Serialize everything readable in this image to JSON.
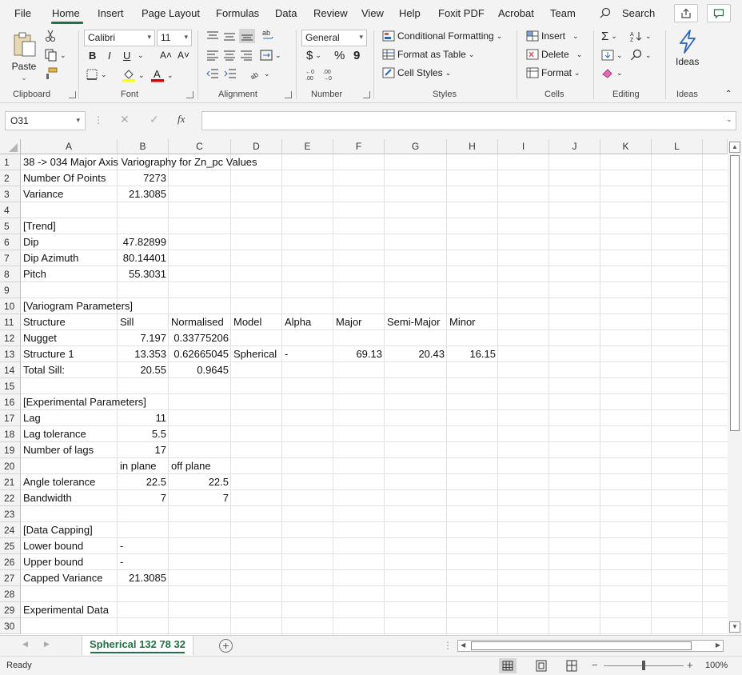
{
  "menu": {
    "items": [
      "File",
      "Home",
      "Insert",
      "Page Layout",
      "Formulas",
      "Data",
      "Review",
      "View",
      "Help",
      "Foxit PDF",
      "Acrobat",
      "Team"
    ],
    "search_label": "Search"
  },
  "ribbon": {
    "clipboard": {
      "label": "Clipboard",
      "paste": "Paste"
    },
    "font": {
      "label": "Font",
      "font_name": "Calibri",
      "font_size": "11",
      "bold": "B",
      "italic": "I",
      "underline": "U",
      "grow": "A˄",
      "shrink": "A˅"
    },
    "alignment": {
      "label": "Alignment"
    },
    "number": {
      "label": "Number",
      "format": "General",
      "currency": "$",
      "percent": "%",
      "comma": "9"
    },
    "styles": {
      "label": "Styles",
      "conditional": "Conditional Formatting",
      "format_table": "Format as Table",
      "cell_styles": "Cell Styles"
    },
    "cells": {
      "label": "Cells",
      "insert": "Insert",
      "delete": "Delete",
      "format": "Format"
    },
    "editing": {
      "label": "Editing"
    },
    "ideas": {
      "label": "Ideas",
      "button": "Ideas"
    }
  },
  "formula_bar": {
    "name_box": "O31",
    "fx": "fx",
    "formula": ""
  },
  "columns": [
    "A",
    "B",
    "C",
    "D",
    "E",
    "F",
    "G",
    "H",
    "I",
    "J",
    "K",
    "L"
  ],
  "rows": [
    "1",
    "2",
    "3",
    "4",
    "5",
    "6",
    "7",
    "8",
    "9",
    "10",
    "11",
    "12",
    "13",
    "14",
    "15",
    "16",
    "17",
    "18",
    "19",
    "20",
    "21",
    "22",
    "23",
    "24",
    "25",
    "26",
    "27",
    "28",
    "29",
    "30"
  ],
  "cells": [
    {
      "r": 1,
      "c": "A",
      "v": "38 -> 034 Major Axis Variography for Zn_pc Values"
    },
    {
      "r": 2,
      "c": "A",
      "v": "Number Of Points"
    },
    {
      "r": 2,
      "c": "B",
      "v": "7273",
      "align": "r"
    },
    {
      "r": 3,
      "c": "A",
      "v": "Variance"
    },
    {
      "r": 3,
      "c": "B",
      "v": "21.3085",
      "align": "r"
    },
    {
      "r": 5,
      "c": "A",
      "v": "[Trend]"
    },
    {
      "r": 6,
      "c": "A",
      "v": "Dip"
    },
    {
      "r": 6,
      "c": "B",
      "v": "47.82899",
      "align": "r"
    },
    {
      "r": 7,
      "c": "A",
      "v": "Dip Azimuth"
    },
    {
      "r": 7,
      "c": "B",
      "v": "80.14401",
      "align": "r"
    },
    {
      "r": 8,
      "c": "A",
      "v": "Pitch"
    },
    {
      "r": 8,
      "c": "B",
      "v": "55.3031",
      "align": "r"
    },
    {
      "r": 10,
      "c": "A",
      "v": "[Variogram Parameters]"
    },
    {
      "r": 11,
      "c": "A",
      "v": "Structure"
    },
    {
      "r": 11,
      "c": "B",
      "v": "Sill"
    },
    {
      "r": 11,
      "c": "C",
      "v": "Normalised"
    },
    {
      "r": 11,
      "c": "D",
      "v": "Model"
    },
    {
      "r": 11,
      "c": "E",
      "v": "Alpha"
    },
    {
      "r": 11,
      "c": "F",
      "v": "Major"
    },
    {
      "r": 11,
      "c": "G",
      "v": "Semi-Major"
    },
    {
      "r": 11,
      "c": "H",
      "v": "Minor"
    },
    {
      "r": 12,
      "c": "A",
      "v": "Nugget"
    },
    {
      "r": 12,
      "c": "B",
      "v": "7.197",
      "align": "r"
    },
    {
      "r": 12,
      "c": "C",
      "v": "0.33775206",
      "align": "r"
    },
    {
      "r": 13,
      "c": "A",
      "v": "Structure 1"
    },
    {
      "r": 13,
      "c": "B",
      "v": "13.353",
      "align": "r"
    },
    {
      "r": 13,
      "c": "C",
      "v": "0.62665045",
      "align": "r"
    },
    {
      "r": 13,
      "c": "D",
      "v": "Spherical"
    },
    {
      "r": 13,
      "c": "E",
      "v": "-"
    },
    {
      "r": 13,
      "c": "F",
      "v": "69.13",
      "align": "r"
    },
    {
      "r": 13,
      "c": "G",
      "v": "20.43",
      "align": "r"
    },
    {
      "r": 13,
      "c": "H",
      "v": "16.15",
      "align": "r"
    },
    {
      "r": 14,
      "c": "A",
      "v": "Total Sill:"
    },
    {
      "r": 14,
      "c": "B",
      "v": "20.55",
      "align": "r"
    },
    {
      "r": 14,
      "c": "C",
      "v": "0.9645",
      "align": "r"
    },
    {
      "r": 16,
      "c": "A",
      "v": "[Experimental Parameters]"
    },
    {
      "r": 17,
      "c": "A",
      "v": "Lag"
    },
    {
      "r": 17,
      "c": "B",
      "v": "11",
      "align": "r"
    },
    {
      "r": 18,
      "c": "A",
      "v": "Lag tolerance"
    },
    {
      "r": 18,
      "c": "B",
      "v": "5.5",
      "align": "r"
    },
    {
      "r": 19,
      "c": "A",
      "v": "Number of lags"
    },
    {
      "r": 19,
      "c": "B",
      "v": "17",
      "align": "r"
    },
    {
      "r": 20,
      "c": "B",
      "v": "in plane"
    },
    {
      "r": 20,
      "c": "C",
      "v": "off plane"
    },
    {
      "r": 21,
      "c": "A",
      "v": "Angle tolerance"
    },
    {
      "r": 21,
      "c": "B",
      "v": "22.5",
      "align": "r"
    },
    {
      "r": 21,
      "c": "C",
      "v": "22.5",
      "align": "r"
    },
    {
      "r": 22,
      "c": "A",
      "v": "Bandwidth"
    },
    {
      "r": 22,
      "c": "B",
      "v": "7",
      "align": "r"
    },
    {
      "r": 22,
      "c": "C",
      "v": "7",
      "align": "r"
    },
    {
      "r": 24,
      "c": "A",
      "v": "[Data Capping]"
    },
    {
      "r": 25,
      "c": "A",
      "v": "Lower bound"
    },
    {
      "r": 25,
      "c": "B",
      "v": "-"
    },
    {
      "r": 26,
      "c": "A",
      "v": "Upper bound"
    },
    {
      "r": 26,
      "c": "B",
      "v": "-"
    },
    {
      "r": 27,
      "c": "A",
      "v": "Capped Variance"
    },
    {
      "r": 27,
      "c": "B",
      "v": "21.3085",
      "align": "r"
    },
    {
      "r": 29,
      "c": "A",
      "v": "Experimental Data"
    }
  ],
  "sheet_tab": "Spherical 132 78 32",
  "status": {
    "ready": "Ready",
    "zoom": "100%"
  },
  "colors": {
    "accent": "#217346"
  }
}
